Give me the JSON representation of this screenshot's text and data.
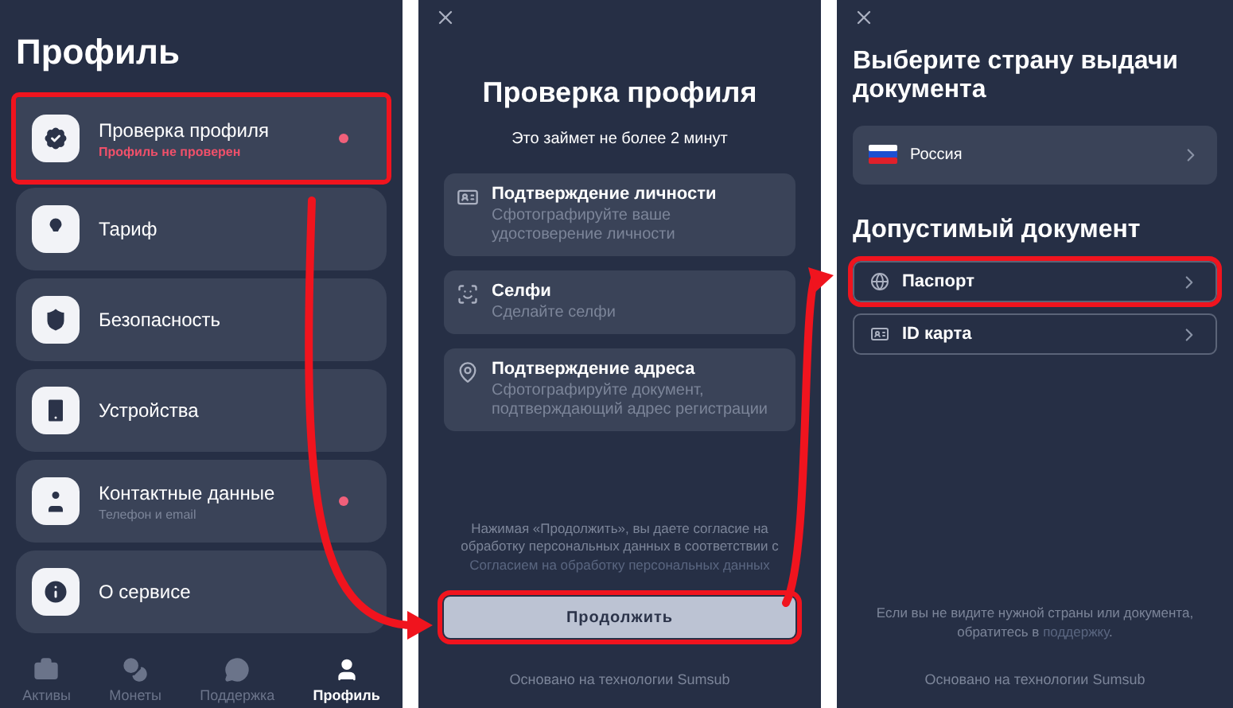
{
  "profile_screen": {
    "title": "Профиль",
    "menu_items": [
      {
        "label": "Проверка профиля",
        "subtitle": "Профиль не проверен",
        "warning": true,
        "dot": true,
        "highlighted": true
      },
      {
        "label": "Тариф",
        "dot": false,
        "highlighted": false
      },
      {
        "label": "Безопасность",
        "dot": false,
        "highlighted": false
      },
      {
        "label": "Устройства",
        "dot": false,
        "highlighted": false
      },
      {
        "label": "Контактные данные",
        "subtitle": "Телефон и email",
        "warning": false,
        "dot": true,
        "highlighted": false
      },
      {
        "label": "О сервисе",
        "dot": false,
        "highlighted": false
      }
    ],
    "bottom_nav": [
      {
        "label": "Активы",
        "selected": false
      },
      {
        "label": "Монеты",
        "selected": false
      },
      {
        "label": "Поддержка",
        "selected": false
      },
      {
        "label": "Профиль",
        "selected": true
      }
    ]
  },
  "verification_screen": {
    "title": "Проверка профиля",
    "subtitle": "Это займет не более 2 минут",
    "steps": [
      {
        "title": "Подтверждение личности",
        "description": "Сфотографируйте ваше удостоверение личности"
      },
      {
        "title": "Селфи",
        "description": "Сделайте селфи"
      },
      {
        "title": "Подтверждение адреса",
        "description": "Сфотографируйте документ, подтверждающий адрес регистрации"
      }
    ],
    "consent": {
      "text": "Нажимая «Продолжить», вы даете согласие на обработку персональных данных в соответствии с",
      "link": "Согласием на обработку персональных данных"
    },
    "button": {
      "label": "Продолжить",
      "highlighted": true
    },
    "footer": "Основано на технологии Sumsub"
  },
  "document_screen": {
    "title": "Выберите страну выдачи документа",
    "country": {
      "name": "Россия"
    },
    "documents_heading": "Допустимый документ",
    "documents": [
      {
        "label": "Паспорт",
        "kind": "passport",
        "highlighted": true
      },
      {
        "label": "ID карта",
        "kind": "id_card",
        "highlighted": false
      }
    ],
    "help": {
      "text": "Если вы не видите нужной страны или документа, обратитесь в",
      "link": "поддержку",
      "end": "."
    },
    "footer": "Основано на технологии Sumsub"
  }
}
